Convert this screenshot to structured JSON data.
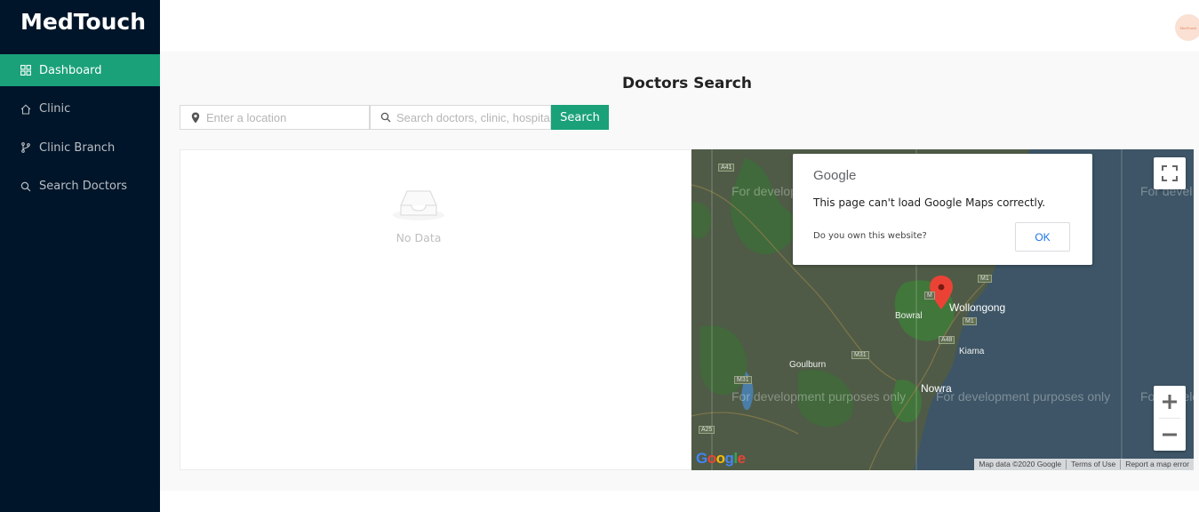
{
  "app": {
    "brand": "MedTouch"
  },
  "sidebar": {
    "items": [
      {
        "label": "Dashboard",
        "icon": "dashboard-icon",
        "active": true
      },
      {
        "label": "Clinic",
        "icon": "home-icon",
        "active": false
      },
      {
        "label": "Clinic Branch",
        "icon": "branch-icon",
        "active": false
      },
      {
        "label": "Search Doctors",
        "icon": "search-icon",
        "active": false
      }
    ]
  },
  "header": {
    "avatar_text": "MedTouch"
  },
  "page": {
    "title": "Doctors Search",
    "location_placeholder": "Enter a location",
    "search_placeholder": "Search doctors, clinic, hospital",
    "search_button": "Search",
    "empty_text": "No Data"
  },
  "map": {
    "dialog": {
      "logo": "Google",
      "message": "This page can't load Google Maps correctly.",
      "question": "Do you own this website?",
      "ok_label": "OK"
    },
    "watermark": "For development purposes only",
    "watermark_short": "For devel",
    "watermark_left": "For develo",
    "labels": {
      "wollongong": "Wollongong",
      "bowral": "Bowral",
      "goulburn": "Goulburn",
      "kiama": "Kiama",
      "nowra": "Nowra"
    },
    "shields": {
      "a41": "A41",
      "m31": "M31",
      "m31b": "M31",
      "a48": "A48",
      "m1": "M1",
      "m1b": "M1",
      "a25": "A25",
      "m": "M"
    },
    "attribution": {
      "data": "Map data ©2020 Google",
      "terms": "Terms of Use",
      "report": "Report a map error"
    },
    "google_logo": "Google"
  },
  "colors": {
    "sidebar_bg": "#001529",
    "accent": "#1aa179",
    "content_bg": "#f9f9f9",
    "map_water": "#3d5566",
    "map_land": "#4d5a45"
  }
}
